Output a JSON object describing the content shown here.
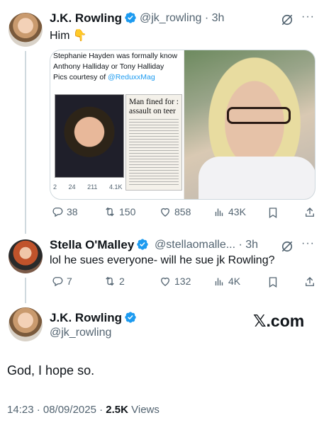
{
  "tweet1": {
    "name": "J.K. Rowling",
    "handle": "@jk_rowling",
    "time": "3h",
    "text": "Him 👇",
    "embedded": {
      "line1_name": "Stephanie Hayden",
      "line1_rest": " was formally know",
      "line2": "Anthony Halliday or Tony Halliday",
      "line3_prefix": "Pics courtesy of ",
      "line3_link": "@ReduxxMag",
      "headline1": "Man fined for :",
      "headline2": "assault on teer",
      "metrics": {
        "replies": "2",
        "reposts": "24",
        "likes": "211",
        "views": "4.1K"
      }
    },
    "metrics": {
      "replies": "38",
      "reposts": "150",
      "likes": "858",
      "views": "43K"
    }
  },
  "tweet2": {
    "name": "Stella O'Malley",
    "handle": "@stellaomalle...",
    "time": "3h",
    "text": "lol he sues everyone- will he sue jk Rowling?",
    "metrics": {
      "replies": "7",
      "reposts": "2",
      "likes": "132",
      "views": "4K"
    }
  },
  "tweet3": {
    "name": "J.K. Rowling",
    "handle": "@jk_rowling",
    "text": "God, I hope so.",
    "timestamp": "14:23 · 08/09/2025 · ",
    "views_count": "2.5K",
    "views_label": " Views"
  },
  "watermark": "𝕏.com",
  "colors": {
    "verified": "#1d9bf0",
    "muted": "#536471",
    "text": "#0f1419",
    "link": "#1d9bf0"
  }
}
